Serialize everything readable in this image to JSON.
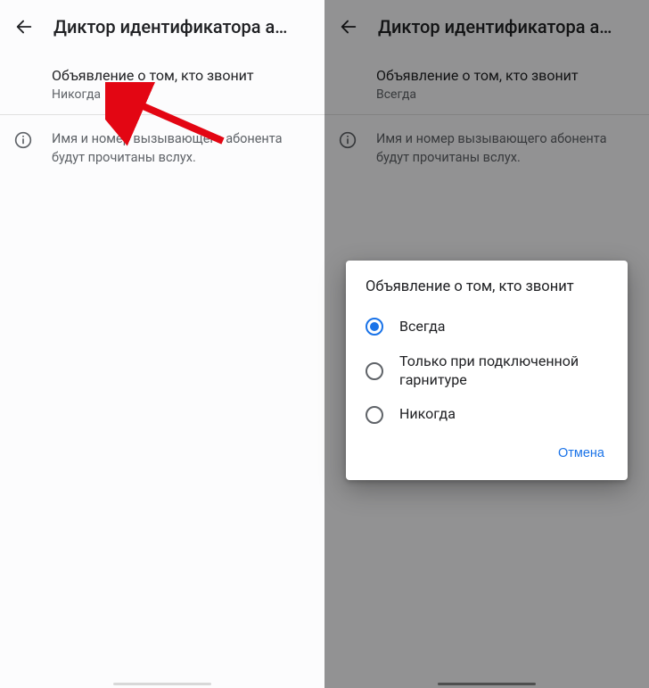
{
  "left": {
    "title": "Диктор идентификатора а…",
    "setting_title": "Объявление о том, кто звонит",
    "setting_value": "Никогда",
    "info_text": "Имя и номер вызывающего абонента будут прочитаны вслух."
  },
  "right": {
    "title": "Диктор идентификатора а…",
    "setting_title": "Объявление о том, кто звонит",
    "setting_value": "Всегда",
    "info_text": "Имя и номер вызывающего абонента будут прочитаны вслух."
  },
  "dialog": {
    "title": "Объявление о том, кто звонит",
    "options": [
      {
        "label": "Всегда",
        "checked": true
      },
      {
        "label": "Только при подключенной гарнитуре",
        "checked": false
      },
      {
        "label": "Никогда",
        "checked": false
      }
    ],
    "cancel": "Отмена"
  },
  "colors": {
    "accent": "#1a73e8",
    "arrow": "#e30613"
  }
}
